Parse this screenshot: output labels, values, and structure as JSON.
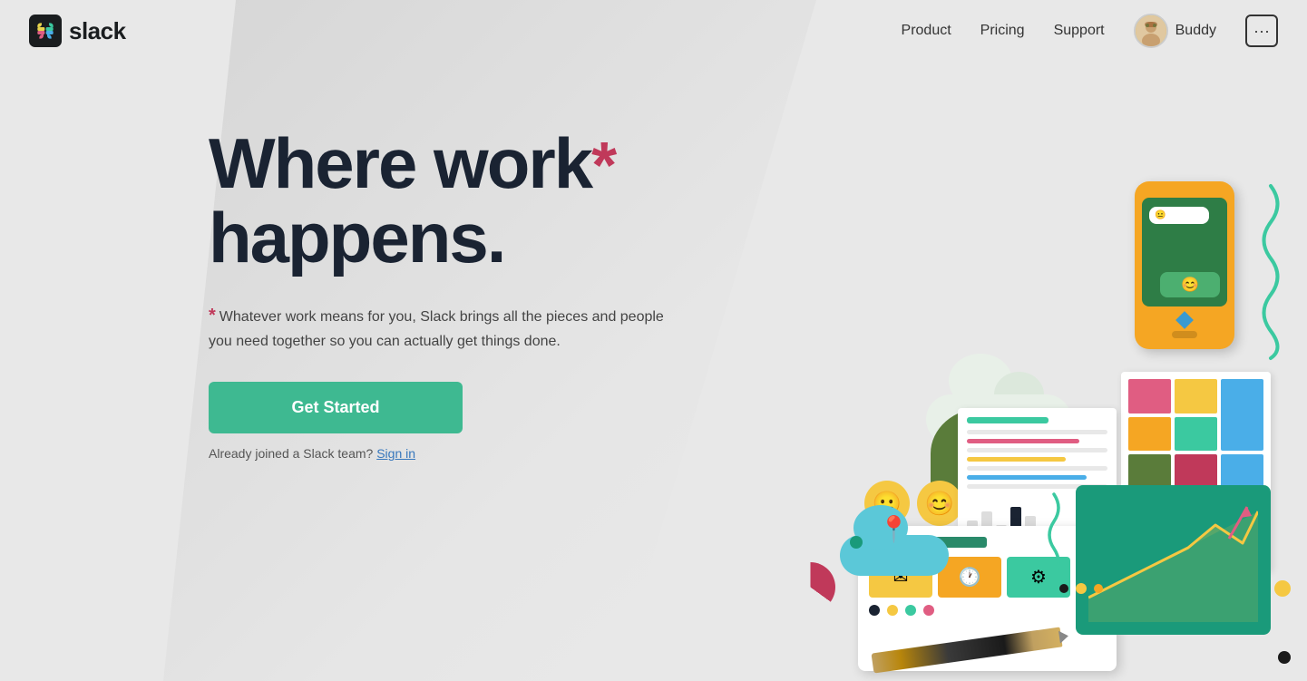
{
  "nav": {
    "logo_text": "slack",
    "links": [
      {
        "label": "Product",
        "id": "product"
      },
      {
        "label": "Pricing",
        "id": "pricing"
      },
      {
        "label": "Support",
        "id": "support"
      }
    ],
    "user": {
      "name": "Buddy"
    },
    "more_button_label": "···"
  },
  "hero": {
    "headline_part1": "Where work",
    "headline_part2": "happens.",
    "asterisk": "*",
    "subtext": "Whatever work means for you, Slack brings all the pieces and people you need together so you can actually get things done.",
    "cta_label": "Get Started",
    "signin_prefix": "Already joined a Slack team?",
    "signin_label": "Sign in"
  },
  "colors": {
    "accent_green": "#3eb991",
    "red_asterisk": "#c0395a",
    "dark_text": "#1a2332",
    "link_blue": "#3777bc"
  },
  "illustration": {
    "phone_emoji1": "😐",
    "phone_emoji2": "😊",
    "face1": "😐",
    "face2": "😊",
    "pin": "📍"
  }
}
